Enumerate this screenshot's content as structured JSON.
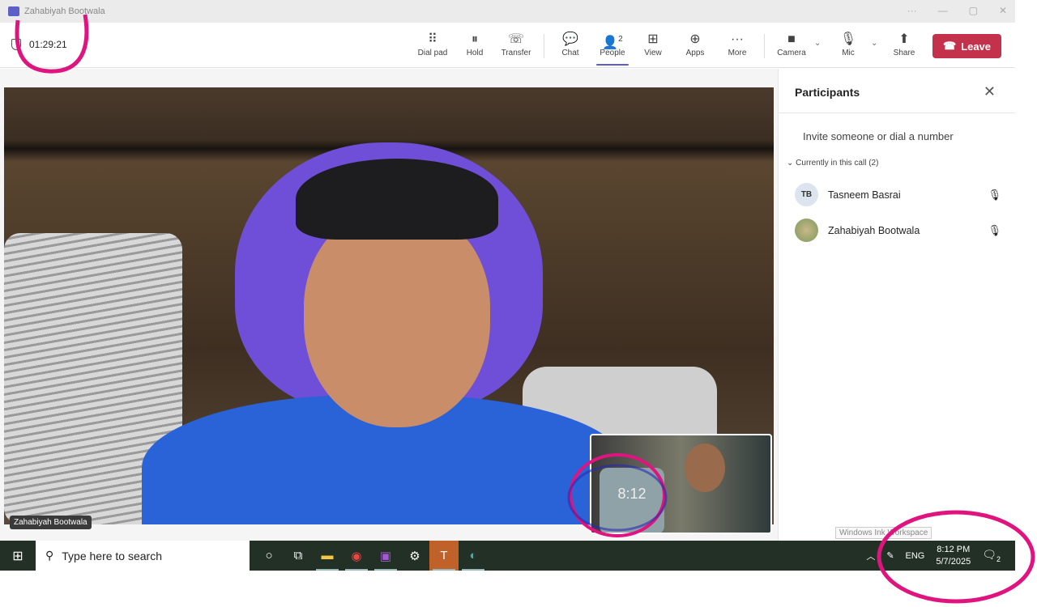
{
  "window": {
    "title": "Zahabiyah Bootwala",
    "controls": [
      "···",
      "—",
      "▢",
      "✕"
    ]
  },
  "call": {
    "timer": "01:29:21"
  },
  "toolbar": {
    "buttons": [
      {
        "label": "Dial pad",
        "icon": "⠿"
      },
      {
        "label": "Hold",
        "icon": "⏸"
      },
      {
        "label": "Transfer",
        "icon": "☏"
      },
      {
        "label": "Chat",
        "icon": "💬"
      },
      {
        "label": "People",
        "icon": "👤",
        "badge": "2"
      },
      {
        "label": "View",
        "icon": "⊞"
      },
      {
        "label": "Apps",
        "icon": "⊕"
      },
      {
        "label": "More",
        "icon": "···"
      },
      {
        "label": "Camera",
        "icon": "■"
      },
      {
        "label": "Mic",
        "icon": "🎙"
      },
      {
        "label": "Share",
        "icon": "⬆"
      }
    ],
    "leave_label": "Leave",
    "leave_color": "#c4314b",
    "accent": "#5b5fc7"
  },
  "stage": {
    "main_name": "Zahabiyah Bootwala",
    "pip_clock": "8:12"
  },
  "panel": {
    "title": "Participants",
    "invite": "Invite someone or dial a number",
    "section": "Currently in this call (2)",
    "people": [
      {
        "initials": "TB",
        "name": "Tasneem Basrai"
      },
      {
        "initials": "",
        "name": "Zahabiyah Bootwala"
      }
    ]
  },
  "taskbar": {
    "search_placeholder": "Type here to search",
    "lang": "ENG",
    "time": "8:12 PM",
    "date": "5/7/2025",
    "notif_count": "2",
    "tooltip": "Windows Ink Workspace"
  }
}
